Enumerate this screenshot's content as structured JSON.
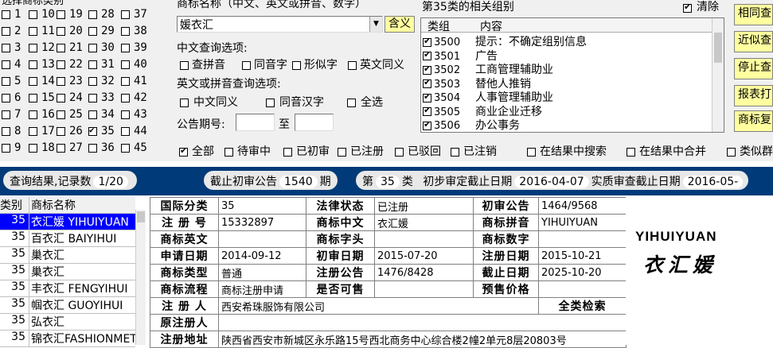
{
  "class_select": {
    "title": "选择商标类别",
    "numbers": [
      "1",
      "10",
      "19",
      "28",
      "37",
      "2",
      "11",
      "20",
      "29",
      "38",
      "3",
      "12",
      "21",
      "30",
      "39",
      "4",
      "13",
      "22",
      "31",
      "40",
      "5",
      "14",
      "23",
      "32",
      "41",
      "6",
      "15",
      "24",
      "33",
      "42",
      "7",
      "16",
      "25",
      "34",
      "43",
      "8",
      "17",
      "26",
      "35",
      "44",
      "9",
      "18",
      "27",
      "36",
      "45"
    ],
    "checked": [
      "35"
    ]
  },
  "search": {
    "name_label": "商标名称（中文、英文或拼音、数字）",
    "name_value": "媛衣汇",
    "match_button": "含义",
    "cn_options_label": "中文查询选项:",
    "cn_options": [
      "查拼音",
      "同音字",
      "形似字",
      "英文同义"
    ],
    "en_options_label": "英文或拼音查询选项:",
    "en_options": [
      "中文同义",
      "同音汉字",
      "全选"
    ],
    "issue_label": "公告期号:",
    "issue_to": "至",
    "filters": [
      "全部",
      "待审中",
      "已初审",
      "已注册",
      "已驳回",
      "已注销",
      "在结果中搜索",
      "在结果中合并",
      "类似群"
    ],
    "filter_checked": [
      "全部"
    ]
  },
  "groups": {
    "title": "第35类的相关组别",
    "clear_label": "清除",
    "clear_checked": true,
    "col_group": "类组",
    "col_content": "内容",
    "rows": [
      {
        "code": "3500",
        "content": "提示：不确定组别信息"
      },
      {
        "code": "3501",
        "content": "广告"
      },
      {
        "code": "3502",
        "content": "工商管理辅助业"
      },
      {
        "code": "3503",
        "content": "替他人推销"
      },
      {
        "code": "3504",
        "content": "人事管理辅助业"
      },
      {
        "code": "3505",
        "content": "商业企业迁移"
      },
      {
        "code": "3506",
        "content": "办公事务"
      }
    ]
  },
  "right_buttons": [
    "相同查",
    "近似查",
    "停止查",
    "报表打",
    "商标复"
  ],
  "status_bar": {
    "result_label": "查询结果,记录数",
    "result_value": "1/20",
    "deadline_label": "截止初审公告",
    "deadline_value": "1540",
    "deadline_unit": "期",
    "class_prefix": "第",
    "class_value": "35",
    "class_suffix": "类",
    "prelim_label": "初步审定截止日期",
    "prelim_value": "2016-04-07",
    "exam_label": "实质审查截止日期",
    "exam_value": "2016-05-"
  },
  "result_list": {
    "col_class": "类别",
    "col_name": "商标名称",
    "rows": [
      {
        "cls": "35",
        "name": "衣汇媛 YIHUIYUAN",
        "selected": true
      },
      {
        "cls": "35",
        "name": "百衣汇 BAIYIHUI"
      },
      {
        "cls": "35",
        "name": "巢衣汇"
      },
      {
        "cls": "35",
        "name": "巢衣汇"
      },
      {
        "cls": "35",
        "name": "丰衣汇 FENGYIHUI"
      },
      {
        "cls": "35",
        "name": "帼衣汇 GUOYIHUI"
      },
      {
        "cls": "35",
        "name": "弘衣汇"
      },
      {
        "cls": "35",
        "name": "锦衣汇FASHIONMET"
      }
    ]
  },
  "detail": {
    "intl_class_k": "国际分类",
    "intl_class_v": "35",
    "legal_status_k": "法律状态",
    "legal_status_v": "已注册",
    "prelim_pub_k": "初审公告",
    "prelim_pub_v": "1464/9568",
    "reg_no_k": "注 册 号",
    "reg_no_v": "15332897",
    "cn_name_k": "商标中文",
    "cn_name_v": "衣汇媛",
    "pinyin_k": "商标拼音",
    "pinyin_v": "YIHUIYUAN",
    "en_name_k": "商标英文",
    "en_name_v": "",
    "initial_k": "商标字头",
    "initial_v": "",
    "digits_k": "商标数字",
    "digits_v": "",
    "apply_date_k": "申请日期",
    "apply_date_v": "2014-09-12",
    "prelim_date_k": "初审日期",
    "prelim_date_v": "2015-07-20",
    "reg_date_k": "注册日期",
    "reg_date_v": "2015-10-21",
    "type_k": "商标类型",
    "type_v": "普通",
    "reg_pub_k": "注册公告",
    "reg_pub_v": "1476/8428",
    "expire_k": "截止日期",
    "expire_v": "2025-10-20",
    "flow_k": "商标流程",
    "flow_v": "商标注册申请",
    "shared_k": "是否可售",
    "shared_v": "",
    "price_k": "预售价格",
    "price_v": "",
    "registrant_k": "注 册 人",
    "registrant_v": "西安希珠服饰有限公司",
    "full_search": "全类检索",
    "orig_registrant_k": "原注册人",
    "orig_registrant_v": "",
    "address_k": "注册地址",
    "address_v": "陕西省西安市新城区永乐路15号西北商务中心综合楼2幢2单元8层20803号"
  },
  "preview": {
    "line1": "YIHUIYUAN",
    "line2": "衣汇媛"
  }
}
